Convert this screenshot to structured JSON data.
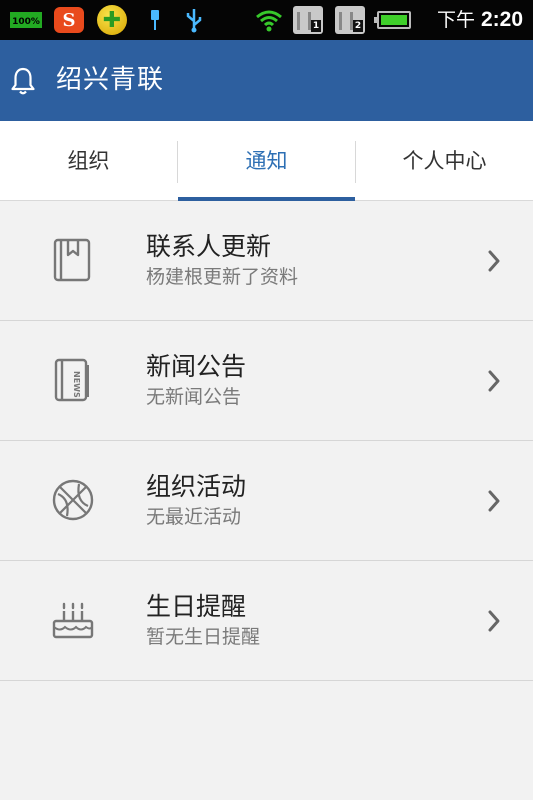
{
  "status_bar": {
    "battery_badge": "100%",
    "app1_letter": "S",
    "sim1": "1",
    "sim2": "2",
    "ampm": "下午",
    "time": "2:20"
  },
  "app_bar": {
    "title": "绍兴青联",
    "icon": "bell-icon"
  },
  "tabs": [
    {
      "label": "组织"
    },
    {
      "label": "通知"
    },
    {
      "label": "个人中心"
    }
  ],
  "active_tab": 1,
  "items": [
    {
      "title": "联系人更新",
      "subtitle": "杨建根更新了资料",
      "icon": "contacts-book-icon"
    },
    {
      "title": "新闻公告",
      "subtitle": "无新闻公告",
      "icon": "news-icon"
    },
    {
      "title": "组织活动",
      "subtitle": "无最近活动",
      "icon": "basketball-icon"
    },
    {
      "title": "生日提醒",
      "subtitle": "暂无生日提醒",
      "icon": "birthday-cake-icon"
    }
  ],
  "colors": {
    "primary": "#2d5f9f",
    "active_tab_text": "#2d6fb4",
    "background": "#f2f2f2"
  }
}
